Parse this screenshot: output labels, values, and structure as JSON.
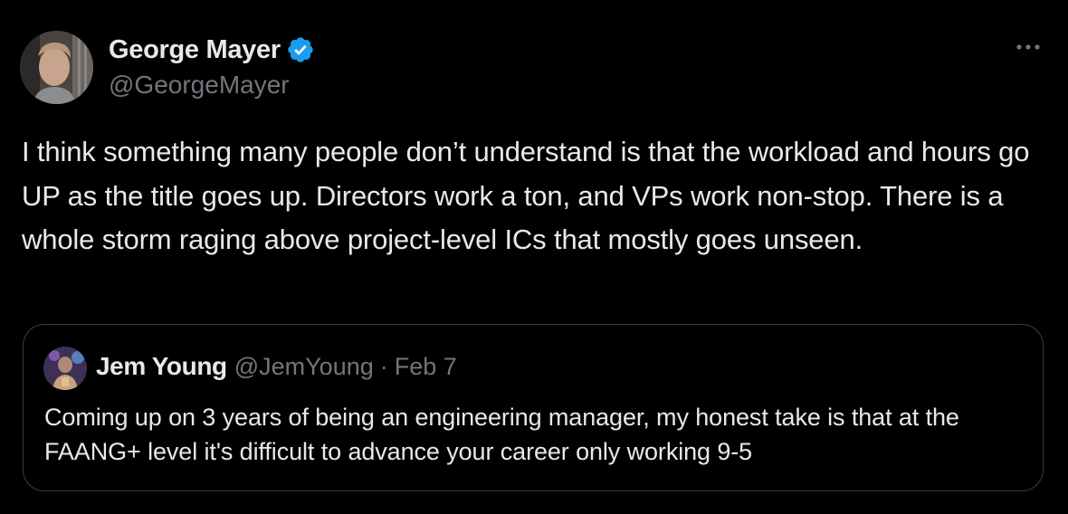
{
  "author": {
    "display_name": "George Mayer",
    "handle": "@GeorgeMayer",
    "verified": true
  },
  "tweet": {
    "text": "I think something many people don’t understand is that the workload and hours go UP as the title goes up. Directors work a ton, and VPs work non-stop. There is a whole storm raging above project-level ICs that mostly goes unseen."
  },
  "quoted_tweet": {
    "display_name": "Jem Young",
    "handle": "@JemYoung",
    "separator": "·",
    "date": "Feb 7",
    "text": "Coming up on 3 years of being an engineering manager, my honest take is that at the FAANG+ level it's difficult to advance your career only working 9-5"
  },
  "icons": {
    "verified": "verified-badge-icon",
    "more": "more-options-icon"
  },
  "colors": {
    "background": "#000000",
    "primary_text": "#e7e9ea",
    "secondary_text": "#71767b",
    "verified_blue": "#1d9bf0",
    "border": "#3a3f44"
  }
}
